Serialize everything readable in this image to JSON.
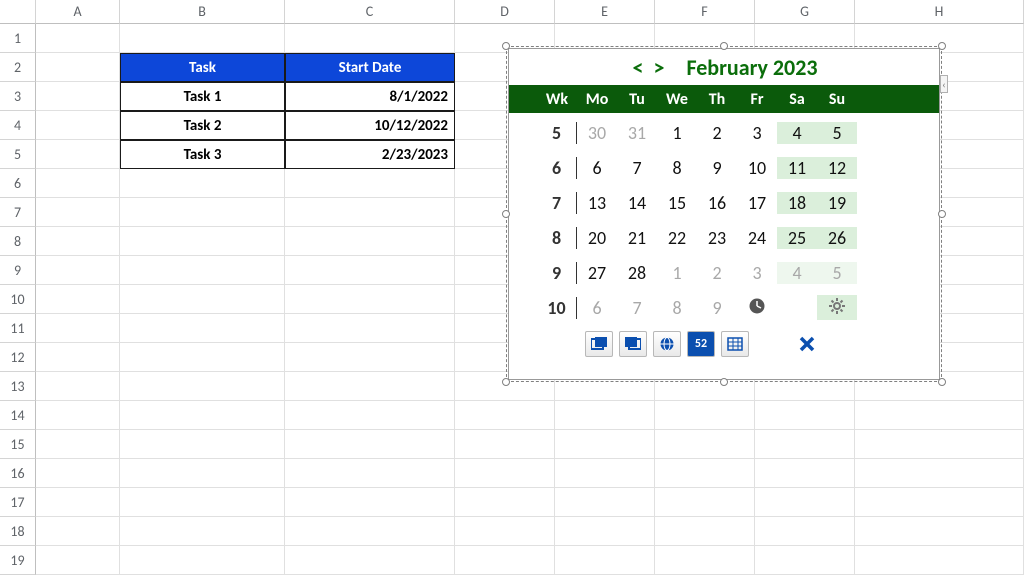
{
  "columns": [
    "A",
    "B",
    "C",
    "D",
    "E",
    "F",
    "G",
    "H"
  ],
  "row_numbers": [
    1,
    2,
    3,
    4,
    5,
    6,
    7,
    8,
    9,
    10,
    11,
    12,
    13,
    14,
    15,
    16,
    17,
    18,
    19
  ],
  "task_table": {
    "headers": {
      "task": "Task",
      "start_date": "Start Date"
    },
    "rows": [
      {
        "task": "Task 1",
        "date": "8/1/2022"
      },
      {
        "task": "Task 2",
        "date": "10/12/2022"
      },
      {
        "task": "Task 3",
        "date": "2/23/2023"
      }
    ]
  },
  "calendar": {
    "prev": "<",
    "next": ">",
    "title": "February 2023",
    "dow": [
      "Wk",
      "Mo",
      "Tu",
      "We",
      "Th",
      "Fr",
      "Sa",
      "Su"
    ],
    "weeks": [
      {
        "wk": 5,
        "days": [
          {
            "n": 30,
            "out": true
          },
          {
            "n": 31,
            "out": true
          },
          {
            "n": 1
          },
          {
            "n": 2
          },
          {
            "n": 3
          },
          {
            "n": 4,
            "wknd": true
          },
          {
            "n": 5,
            "wknd": true
          }
        ]
      },
      {
        "wk": 6,
        "days": [
          {
            "n": 6
          },
          {
            "n": 7
          },
          {
            "n": 8
          },
          {
            "n": 9
          },
          {
            "n": 10
          },
          {
            "n": 11,
            "wknd": true
          },
          {
            "n": 12,
            "wknd": true
          }
        ]
      },
      {
        "wk": 7,
        "days": [
          {
            "n": 13
          },
          {
            "n": 14
          },
          {
            "n": 15
          },
          {
            "n": 16
          },
          {
            "n": 17
          },
          {
            "n": 18,
            "wknd": true
          },
          {
            "n": 19,
            "wknd": true
          }
        ]
      },
      {
        "wk": 8,
        "days": [
          {
            "n": 20
          },
          {
            "n": 21
          },
          {
            "n": 22
          },
          {
            "n": 23
          },
          {
            "n": 24
          },
          {
            "n": 25,
            "wknd": true
          },
          {
            "n": 26,
            "wknd": true
          }
        ]
      },
      {
        "wk": 9,
        "days": [
          {
            "n": 27
          },
          {
            "n": 28
          },
          {
            "n": 1,
            "out": true
          },
          {
            "n": 2,
            "out": true
          },
          {
            "n": 3,
            "out": true
          },
          {
            "n": 4,
            "wknd": true,
            "out": true
          },
          {
            "n": 5,
            "wknd": true,
            "out": true
          }
        ]
      },
      {
        "wk": 10,
        "days": [
          {
            "n": 6,
            "out": true
          },
          {
            "n": 7,
            "out": true
          },
          {
            "n": 8,
            "out": true
          },
          {
            "n": 9,
            "out": true
          },
          {
            "icon": "clock"
          },
          {
            "blank": true,
            "wknd": true
          },
          {
            "icon": "gear",
            "wknd": true
          }
        ]
      }
    ],
    "toolbar": {
      "btn1": "window-paste",
      "btn2": "window-copy",
      "btn3": "globe",
      "btn4_label": "52",
      "btn5": "grid",
      "close": "✕"
    },
    "notch": "‹"
  }
}
